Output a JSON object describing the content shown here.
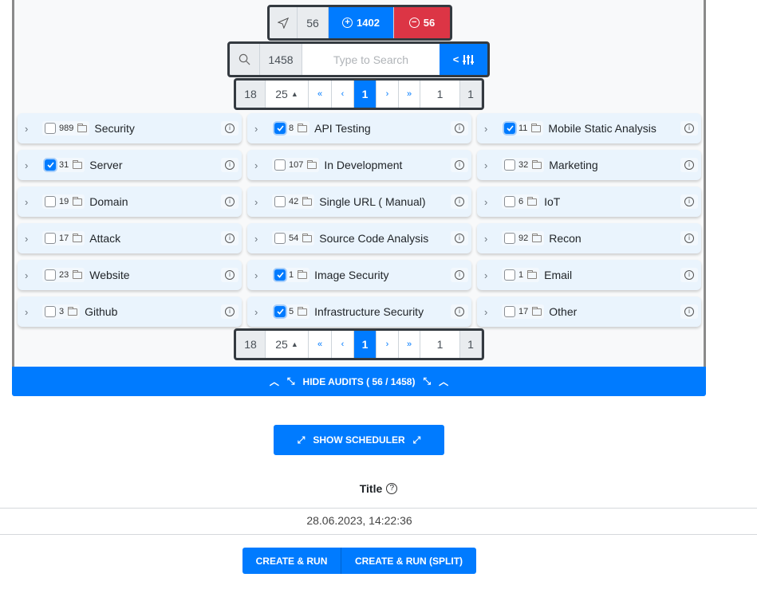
{
  "toolbar": {
    "selected_count": "56",
    "add_count": "1402",
    "remove_count": "56"
  },
  "search": {
    "total": "1458",
    "placeholder": "Type to Search",
    "filter_label": "<"
  },
  "pagination": {
    "pages": "18",
    "per_page": "25",
    "first": "«",
    "prev": "‹",
    "current": "1",
    "next": "›",
    "last": "»",
    "goto": "1",
    "total": "1"
  },
  "categories": [
    {
      "count": "989",
      "label": "Security",
      "checked": false
    },
    {
      "count": "8",
      "label": "API Testing",
      "checked": true
    },
    {
      "count": "11",
      "label": "Mobile Static Analysis",
      "checked": true
    },
    {
      "count": "31",
      "label": "Server",
      "checked": true
    },
    {
      "count": "107",
      "label": "In Development",
      "checked": false
    },
    {
      "count": "32",
      "label": "Marketing",
      "checked": false
    },
    {
      "count": "19",
      "label": "Domain",
      "checked": false
    },
    {
      "count": "42",
      "label": "Single URL ( Manual)",
      "checked": false
    },
    {
      "count": "6",
      "label": "IoT",
      "checked": false
    },
    {
      "count": "17",
      "label": "Attack",
      "checked": false
    },
    {
      "count": "54",
      "label": "Source Code Analysis",
      "checked": false
    },
    {
      "count": "92",
      "label": "Recon",
      "checked": false
    },
    {
      "count": "23",
      "label": "Website",
      "checked": false
    },
    {
      "count": "1",
      "label": "Image Security",
      "checked": true
    },
    {
      "count": "1",
      "label": "Email",
      "checked": false
    },
    {
      "count": "3",
      "label": "Github",
      "checked": false
    },
    {
      "count": "5",
      "label": "Infrastructure Security",
      "checked": true
    },
    {
      "count": "17",
      "label": "Other",
      "checked": false
    }
  ],
  "hide_audits": "HIDE AUDITS ( 56 / 1458)",
  "show_scheduler": "SHOW SCHEDULER",
  "title_label": "Title",
  "title_value": "28.06.2023, 14:22:36",
  "actions": {
    "create_run": "CREATE & RUN",
    "create_run_split": "CREATE & RUN (SPLIT)"
  },
  "colors": {
    "primary": "#007bff",
    "danger": "#dc3545",
    "dark": "#343a40"
  }
}
